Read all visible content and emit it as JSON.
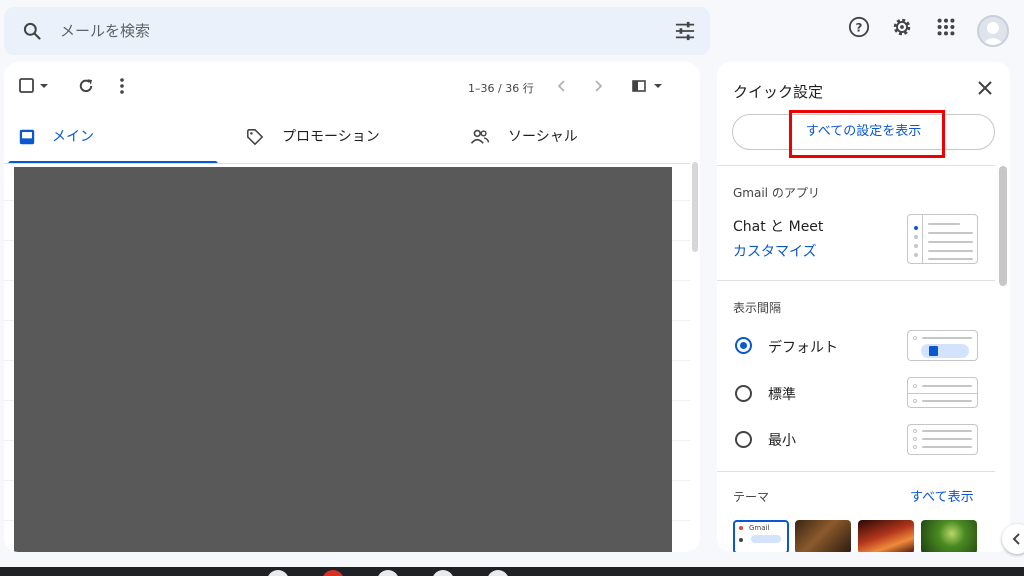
{
  "search": {
    "placeholder": "メールを検索"
  },
  "header_icons": [
    "help-icon",
    "settings-icon",
    "apps-grid-icon",
    "account-avatar"
  ],
  "toolbar": {
    "pagination": "1–36 / 36 行"
  },
  "tabs": [
    {
      "label": "メイン",
      "active": true,
      "icon": "inbox-icon"
    },
    {
      "label": "プロモーション",
      "active": false,
      "icon": "tag-icon"
    },
    {
      "label": "ソーシャル",
      "active": false,
      "icon": "people-icon"
    }
  ],
  "quick_settings": {
    "title": "クイック設定",
    "see_all_button": "すべての設定を表示",
    "apps_section": {
      "heading": "Gmail のアプリ",
      "item": "Chat と Meet",
      "customize_link": "カスタマイズ"
    },
    "density_section": {
      "heading": "表示間隔",
      "options": [
        {
          "label": "デフォルト",
          "selected": true
        },
        {
          "label": "標準",
          "selected": false
        },
        {
          "label": "最小",
          "selected": false
        }
      ]
    },
    "theme_section": {
      "heading": "テーマ",
      "see_all_link": "すべて表示",
      "thumb_text": "Gmail"
    }
  },
  "colors": {
    "accent": "#0b57d0",
    "search_bg": "#eaf1fb",
    "page_bg": "#f6f8fc",
    "highlight": "#e00000",
    "redacted_block": "#595959"
  }
}
